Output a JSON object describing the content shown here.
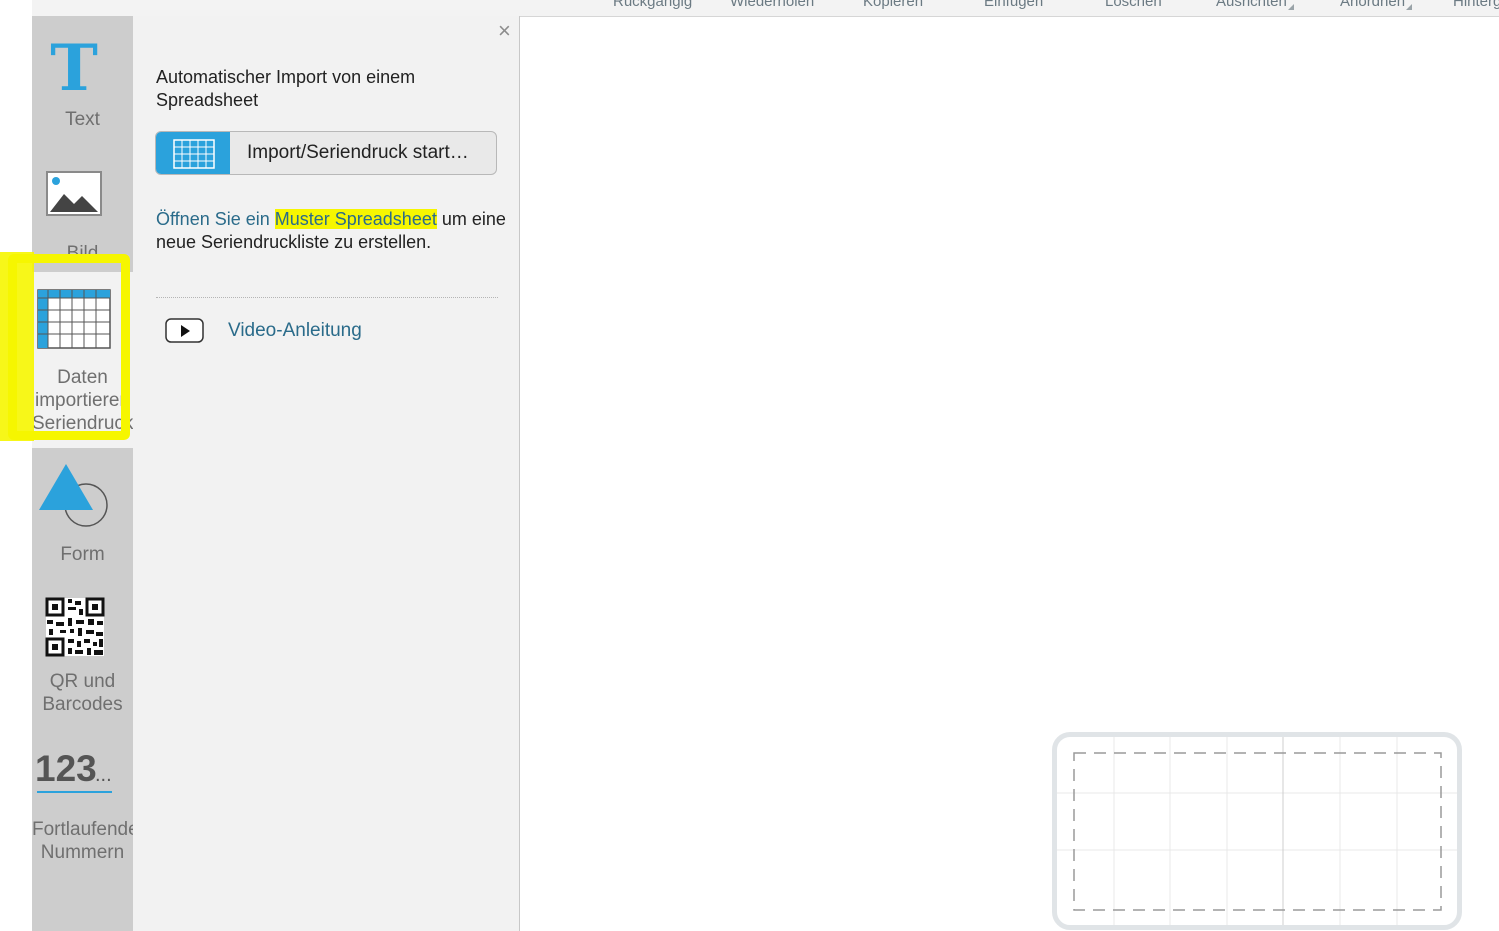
{
  "toolbar": {
    "items": [
      {
        "label": "Rückgängig"
      },
      {
        "label": "Wiederholen"
      },
      {
        "label": "Kopieren"
      },
      {
        "label": "Einfügen"
      },
      {
        "label": "Löschen"
      },
      {
        "label": "Ausrichten"
      },
      {
        "label": "Anordnen"
      },
      {
        "label": "Hintergr"
      }
    ]
  },
  "sidebar": {
    "items": [
      {
        "label": "Text",
        "icon": "text-icon"
      },
      {
        "label": "Bild",
        "icon": "image-icon"
      },
      {
        "label_lines": [
          "Daten",
          "importieren",
          "Seriendruck"
        ],
        "icon": "spreadsheet-icon"
      },
      {
        "label": "Form",
        "icon": "shape-icon"
      },
      {
        "label_lines": [
          "QR und",
          "Barcodes"
        ],
        "icon": "qr-code-icon"
      },
      {
        "icon_text": "123",
        "icon_suffix": "...",
        "label_lines": [
          "Fortlaufende",
          "Nummern"
        ],
        "icon": "numbering-icon"
      }
    ]
  },
  "panel": {
    "close_symbol": "×",
    "heading": "Automatischer Import von einem Spreadsheet",
    "import_button_label": "Import/Seriendruck start…",
    "help_text": {
      "link1": "Öffnen Sie ein ",
      "link_highlight": "Muster Spreadsheet",
      "rest": " um eine neue Seriendruckliste zu erstellen."
    },
    "video_label": "Video-Anleitung"
  },
  "colors": {
    "accent": "#2ba2dc",
    "highlight": "#f6f600",
    "link": "#2a6b8a",
    "sidebar_bg": "#cdcdcd",
    "panel_bg": "#f2f2f2"
  }
}
